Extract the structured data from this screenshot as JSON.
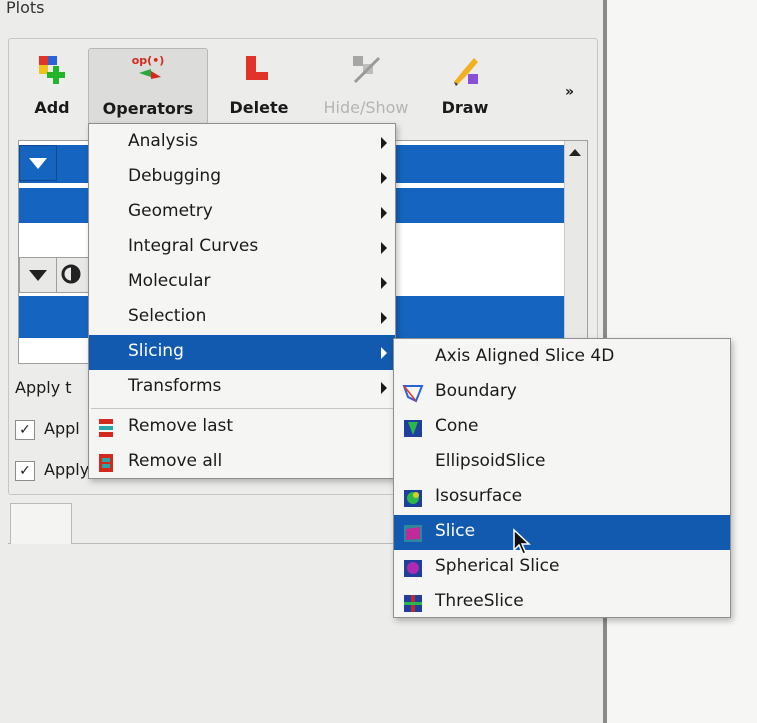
{
  "window": {
    "group_title": "Plots"
  },
  "toolbar": {
    "add_label": "Add",
    "operators_label": "Operators",
    "operators_icon_text": "op(•)",
    "delete_label": "Delete",
    "hideshow_label": "Hide/Show",
    "draw_label": "Draw",
    "more_label": "»"
  },
  "apply_section": {
    "label": "Apply t",
    "check1_label": "Appl",
    "check2_label": "Apply",
    "check_mark": "✓"
  },
  "operators_menu": {
    "items": [
      {
        "label": "Analysis"
      },
      {
        "label": "Debugging"
      },
      {
        "label": "Geometry"
      },
      {
        "label": "Integral Curves"
      },
      {
        "label": "Molecular"
      },
      {
        "label": "Selection"
      },
      {
        "label": "Slicing"
      },
      {
        "label": "Transforms"
      }
    ],
    "remove_last": "Remove last",
    "remove_all": "Remove all"
  },
  "slicing_menu": {
    "items": [
      {
        "label": "Axis Aligned Slice 4D",
        "icon": "none"
      },
      {
        "label": "Boundary",
        "icon": "boundary-icon"
      },
      {
        "label": "Cone",
        "icon": "cone-icon"
      },
      {
        "label": "EllipsoidSlice",
        "icon": "none"
      },
      {
        "label": "Isosurface",
        "icon": "isosurface-icon"
      },
      {
        "label": "Slice",
        "icon": "slice-icon"
      },
      {
        "label": "Spherical Slice",
        "icon": "spherical-slice-icon"
      },
      {
        "label": "ThreeSlice",
        "icon": "threeslice-icon"
      }
    ]
  },
  "colors": {
    "highlight": "#1259b0",
    "list_selection": "#1565c0",
    "panel_bg": "#ececea"
  }
}
